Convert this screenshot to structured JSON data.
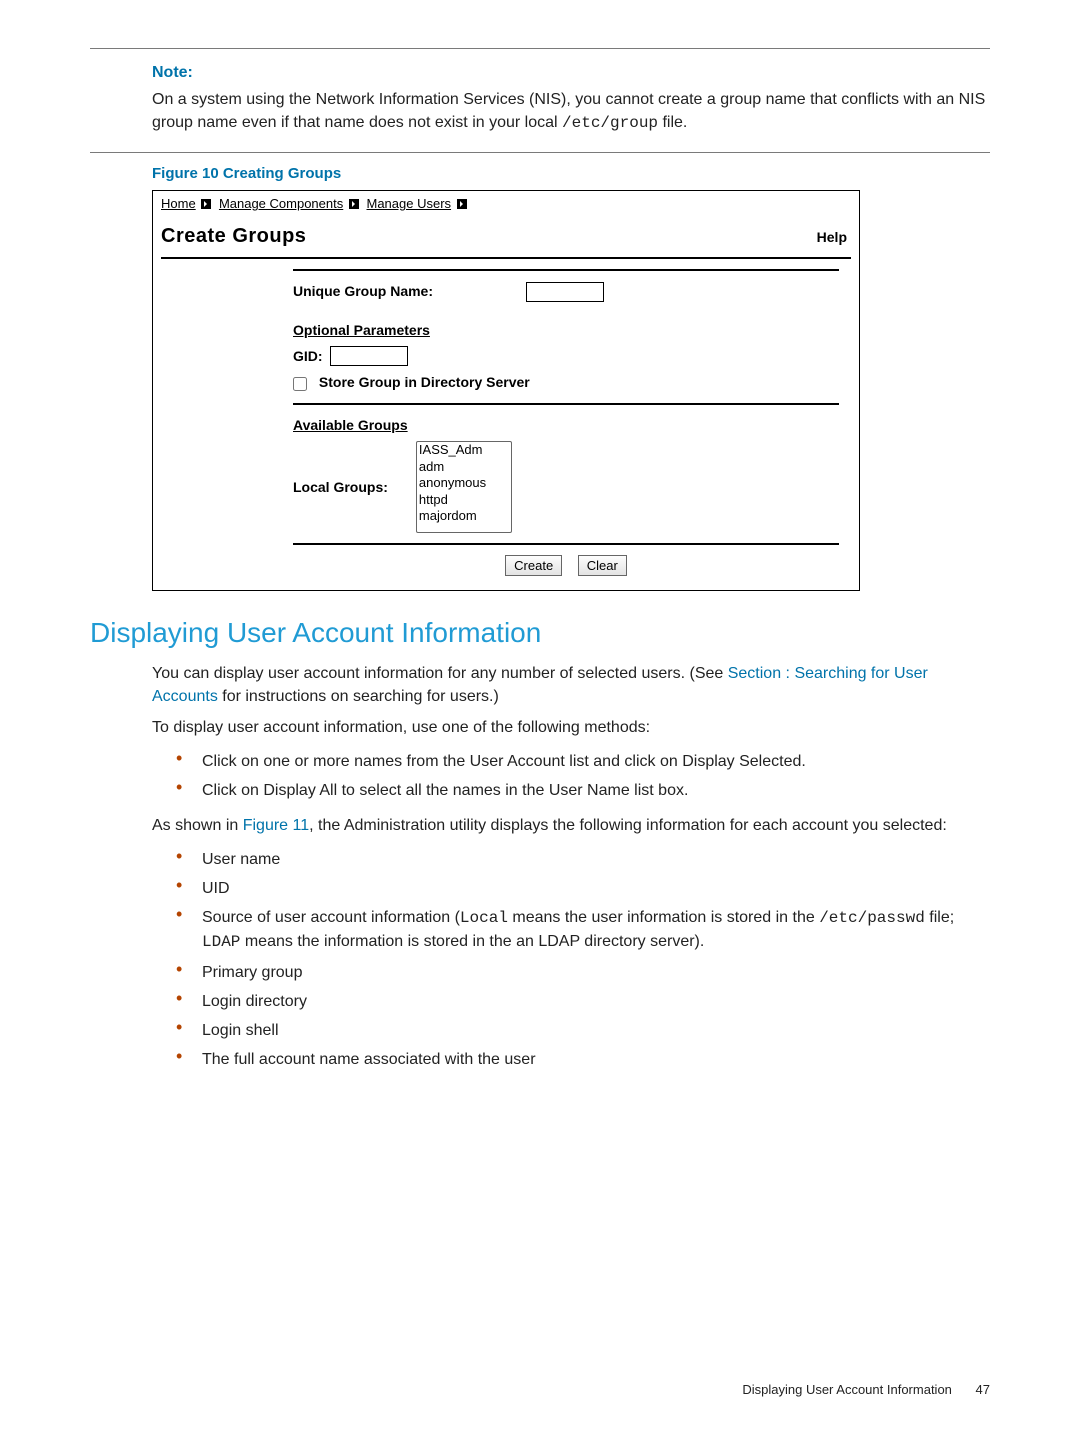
{
  "note": {
    "label": "Note:",
    "body_pre": "On a system using the Network Information Services (NIS), you cannot create a group name that conflicts with an NIS group name even if that name does not exist in your local ",
    "body_code": "/etc/group",
    "body_post": " file."
  },
  "figure": {
    "caption": "Figure 10 Creating Groups",
    "breadcrumb": {
      "home": "Home",
      "mc": "Manage Components",
      "mu": "Manage Users"
    },
    "title": "Create Groups",
    "help": "Help",
    "unique_label": "Unique Group Name:",
    "optional_header": "Optional Parameters",
    "gid_label": "GID:",
    "store_label": "Store Group in Directory Server",
    "available_header": "Available Groups",
    "local_label": "Local Groups:",
    "groups": [
      "IASS_Adm",
      "adm",
      "anonymous",
      "httpd",
      "majordom"
    ],
    "create_btn": "Create",
    "clear_btn": "Clear"
  },
  "section": {
    "heading": "Displaying User Account Information",
    "p1_pre": "You can display user account information for any number of selected users. (See ",
    "p1_link": "Section : Searching for User Accounts",
    "p1_post": " for instructions on searching for users.)",
    "p2": "To display user account information, use one of the following methods:",
    "methods": [
      "Click on one or more names from the User Account list and click on Display Selected.",
      "Click on Display All to select all the names in the User Name list box."
    ],
    "p3_pre": "As shown in ",
    "p3_link": "Figure 11",
    "p3_post": ", the Administration utility displays the following information for each account you selected:",
    "info_items_pre": [
      "User name",
      "UID"
    ],
    "info_source": {
      "pre": "Source of user account information (",
      "c1": "Local",
      "mid1": " means the user information is stored in the ",
      "c2": "/etc/passwd",
      "mid2": " file; ",
      "c3": "LDAP",
      "post": " means the information is stored in the an LDAP directory server)."
    },
    "info_items_post": [
      "Primary group",
      "Login directory",
      "Login shell",
      "The full account name associated with the user"
    ]
  },
  "footer": {
    "title": "Displaying User Account Information",
    "page": "47"
  }
}
